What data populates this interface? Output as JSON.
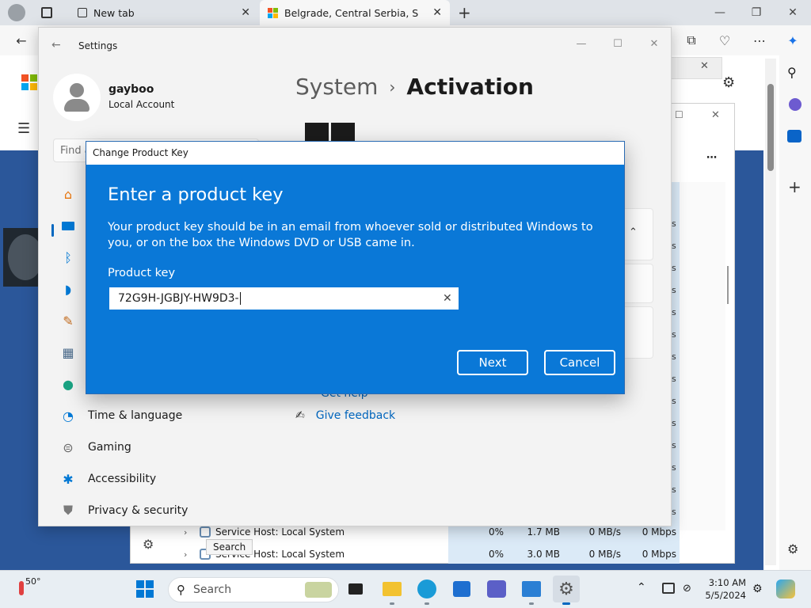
{
  "browser": {
    "tabs": [
      {
        "label": "New tab"
      },
      {
        "label": "Belgrade, Central Serbia, Serbia"
      }
    ]
  },
  "taskmgr": {
    "rows": [
      {
        "name": "Service Host: Local System",
        "cpu": "0%",
        "memory": "1.7 MB",
        "disk": "0 MB/s",
        "network": "0 Mbps"
      },
      {
        "name": "Service Host: Local System",
        "cpu": "0%",
        "memory": "3.0 MB",
        "disk": "0 MB/s",
        "network": "0 Mbps"
      }
    ],
    "side_unit": "s"
  },
  "settings": {
    "window_title": "Settings",
    "user": {
      "name": "gayboo",
      "account_type": "Local Account"
    },
    "search_placeholder": "Find a setting",
    "breadcrumb": {
      "parent": "System",
      "separator": "›",
      "current": "Activation"
    },
    "nav": [
      {
        "label": "Time & language",
        "icon": "globe-clock-icon"
      },
      {
        "label": "Gaming",
        "icon": "gamepad-icon"
      },
      {
        "label": "Accessibility",
        "icon": "accessibility-icon"
      },
      {
        "label": "Privacy & security",
        "icon": "shield-icon"
      }
    ],
    "links": {
      "get_help": "Get help",
      "give_feedback": "Give feedback"
    }
  },
  "dialog": {
    "title": "Change Product Key",
    "heading": "Enter a product key",
    "description": "Your product key should be in an email from whoever sold or distributed Windows to you, or on the box the Windows DVD or USB came in.",
    "field_label": "Product key",
    "field_value": "72G9H-JGBJY-HW9D3-",
    "next_label": "Next",
    "cancel_label": "Cancel"
  },
  "taskbar": {
    "weather": "50°",
    "search_placeholder": "Search",
    "search_tooltip": "Search",
    "clock_time": "3:10 AM",
    "clock_date": "5/5/2024"
  },
  "colors": {
    "dialog_blue": "#0a78d7",
    "accent": "#0067c0"
  }
}
